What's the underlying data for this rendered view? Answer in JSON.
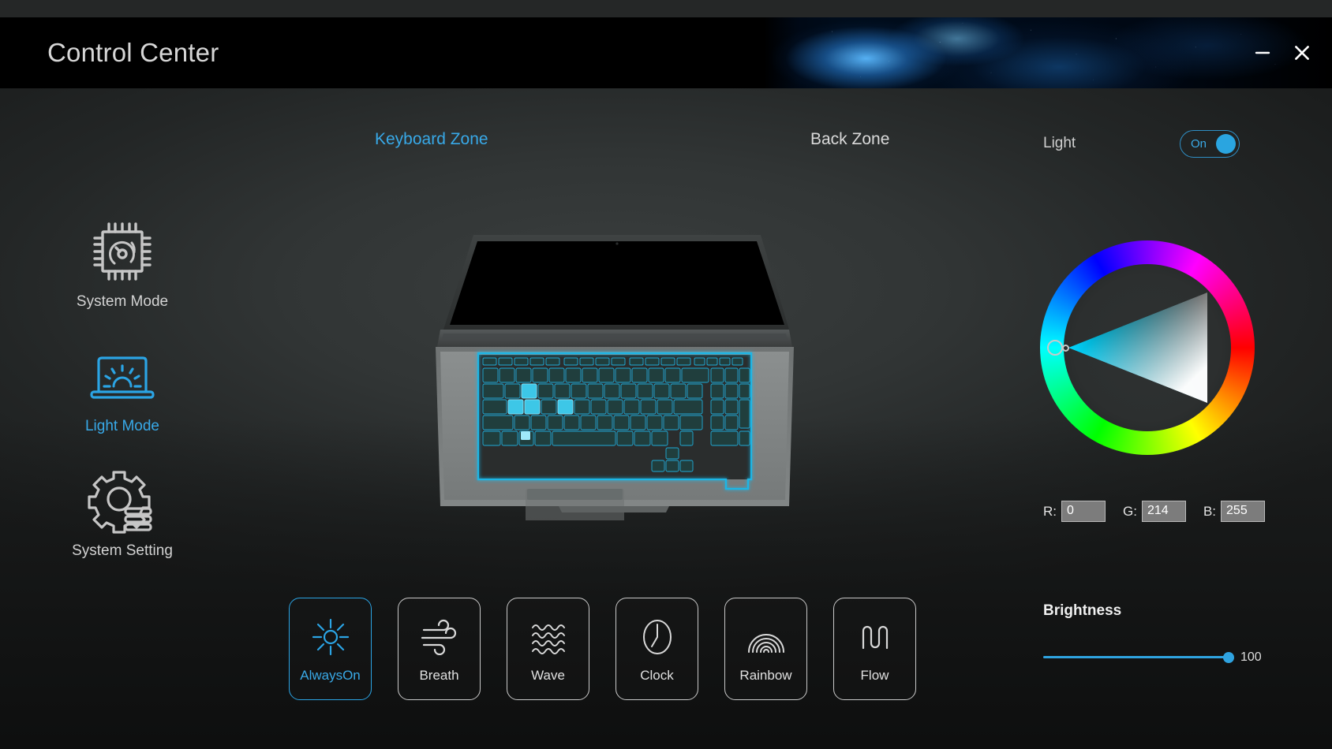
{
  "window": {
    "title": "Control Center",
    "minimize_icon": "minimize-icon",
    "close_icon": "close-icon"
  },
  "zones": {
    "tabs": [
      {
        "label": "Keyboard Zone",
        "active": true
      },
      {
        "label": "Back Zone",
        "active": false
      }
    ]
  },
  "light_switch": {
    "label": "Light",
    "state": "On"
  },
  "sidebar": {
    "items": [
      {
        "label": "System Mode",
        "icon": "cpu-gauge-icon",
        "active": false
      },
      {
        "label": "Light Mode",
        "icon": "laptop-backlight-icon",
        "active": true
      },
      {
        "label": "System Setting",
        "icon": "gear-stack-icon",
        "active": false
      }
    ]
  },
  "preview": {
    "device": "laptop-keyboard-preview",
    "backlight_color": "#1fb6e6",
    "highlighted_keys": [
      "W",
      "A",
      "S",
      "D"
    ]
  },
  "effects": {
    "buttons": [
      {
        "label": "AlwaysOn",
        "icon": "sun-icon",
        "active": true
      },
      {
        "label": "Breath",
        "icon": "wind-icon",
        "active": false
      },
      {
        "label": "Wave",
        "icon": "waves-icon",
        "active": false
      },
      {
        "label": "Clock",
        "icon": "clock-icon",
        "active": false
      },
      {
        "label": "Rainbow",
        "icon": "rainbow-icon",
        "active": false
      },
      {
        "label": "Flow",
        "icon": "flow-icon",
        "active": false
      }
    ]
  },
  "color_picker": {
    "wheel_icon": "color-wheel",
    "cursor_icon": "color-cursor-icon",
    "r_label": "R:",
    "g_label": "G:",
    "b_label": "B:",
    "r_value": "0",
    "g_value": "214",
    "b_value": "255"
  },
  "brightness": {
    "title": "Brightness",
    "value": "100"
  },
  "colors": {
    "accent": "#2ba4e4",
    "accent_text": "#38a9e8",
    "background": "#1b1d1d",
    "titlebar": "#000000",
    "selected_color": "#00d6ff"
  }
}
